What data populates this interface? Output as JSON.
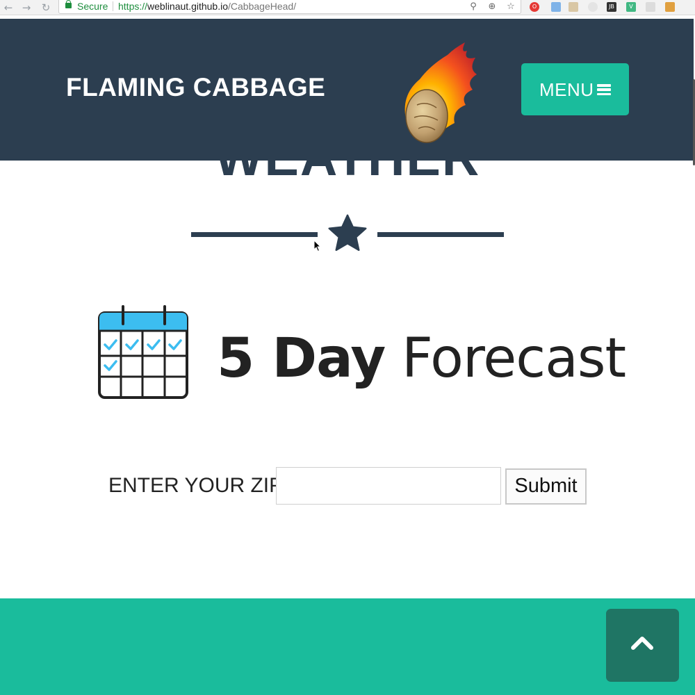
{
  "browser": {
    "back_icon": "arrow-left-icon",
    "forward_icon": "arrow-right-icon",
    "reload_icon": "reload-icon",
    "secure_label": "Secure",
    "url": {
      "scheme": "https://",
      "host": "weblinaut.github.io",
      "path": "/CabbageHead/"
    },
    "extension_labels": {
      "jetbrains": "JB"
    }
  },
  "header": {
    "brand": "FLAMING CABBAGE",
    "logo_icon": "flaming-cabbage-icon",
    "menu_label": "MENU",
    "menu_icon": "hamburger-icon"
  },
  "section": {
    "title": "WEATHER",
    "divider_icon": "star-icon"
  },
  "forecast": {
    "bold_text": "5 Day",
    "light_text": " Forecast",
    "calendar_icon": "calendar-icon"
  },
  "zip_form": {
    "label": "ENTER YOUR ZIP",
    "input_value": "",
    "submit_label": "Submit"
  },
  "footer": {
    "scroll_top_icon": "chevron-up-icon"
  },
  "colors": {
    "navbar": "#2c3e50",
    "accent": "#1abc9c",
    "scroll_top": "#1f7564",
    "calendar_blue": "#3cbdf0"
  }
}
